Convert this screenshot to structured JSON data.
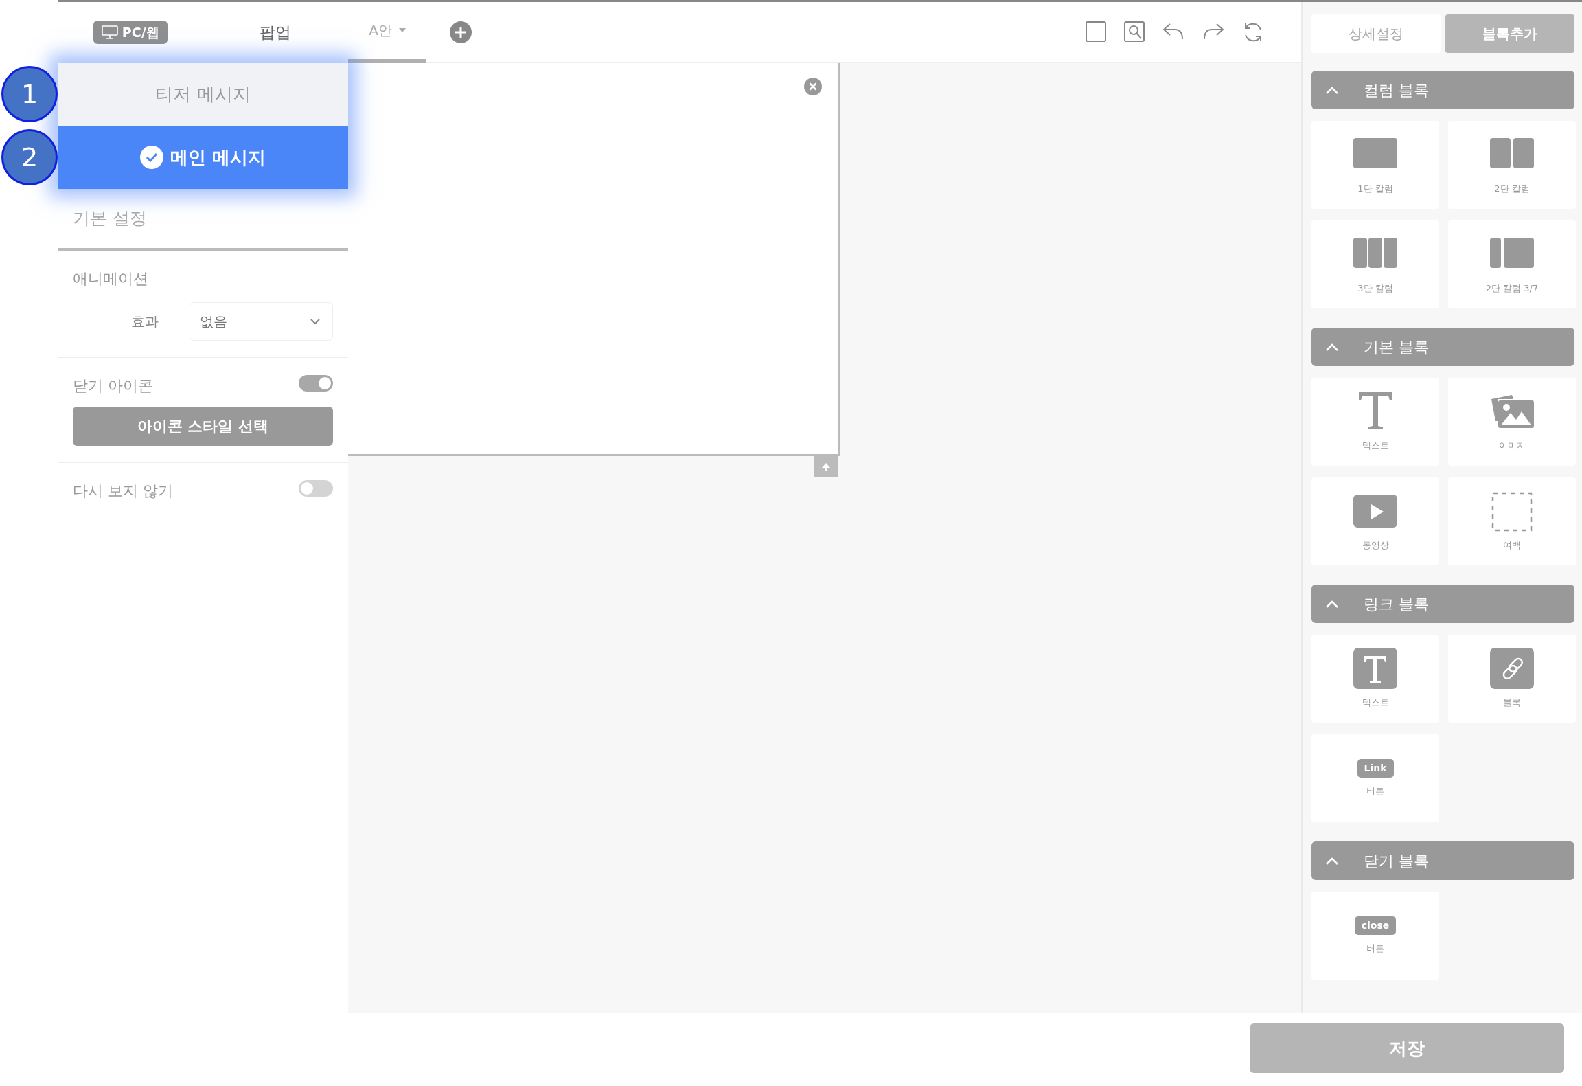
{
  "left_panel": {
    "device_badge": "PC/웹",
    "title": "팝업",
    "message_tabs": [
      {
        "label": "티저 메시지",
        "selected": false,
        "marker": "1"
      },
      {
        "label": "메인 메시지",
        "selected": true,
        "marker": "2"
      }
    ],
    "section_title": "기본 설정",
    "animation": {
      "title": "애니메이션",
      "effect_label": "효과",
      "effect_value": "없음"
    },
    "close_icon": {
      "label": "닫기 아이콘",
      "on": true,
      "button": "아이콘 스타일 선택"
    },
    "dont_show_again": {
      "label": "다시 보지 않기",
      "on": false
    }
  },
  "editor": {
    "tabs": [
      {
        "label": "A안",
        "selected": true
      }
    ]
  },
  "right_panel": {
    "tabs": [
      {
        "label": "상세설정",
        "selected": false
      },
      {
        "label": "블록추가",
        "selected": true
      }
    ],
    "groups": [
      {
        "title": "컬럼 블록",
        "expanded": true,
        "items": [
          {
            "label": "1단 칼럼",
            "kind": "col1"
          },
          {
            "label": "2단 칼럼",
            "kind": "col2"
          },
          {
            "label": "3단 칼럼",
            "kind": "col3"
          },
          {
            "label": "2단 칼럼 3/7",
            "kind": "col37"
          }
        ]
      },
      {
        "title": "기본 블록",
        "expanded": true,
        "items": [
          {
            "label": "텍스트",
            "kind": "text"
          },
          {
            "label": "이미지",
            "kind": "image"
          },
          {
            "label": "동영상",
            "kind": "video"
          },
          {
            "label": "여백",
            "kind": "spacer"
          }
        ]
      },
      {
        "title": "링크 블록",
        "expanded": true,
        "items": [
          {
            "label": "텍스트",
            "kind": "textbox"
          },
          {
            "label": "블록",
            "kind": "chain"
          },
          {
            "label": "버튼",
            "kind": "badge",
            "badge": "Link"
          }
        ]
      },
      {
        "title": "닫기 블록",
        "expanded": true,
        "items": [
          {
            "label": "버튼",
            "kind": "badge",
            "badge": "close"
          }
        ]
      }
    ]
  },
  "save_button": "저장"
}
